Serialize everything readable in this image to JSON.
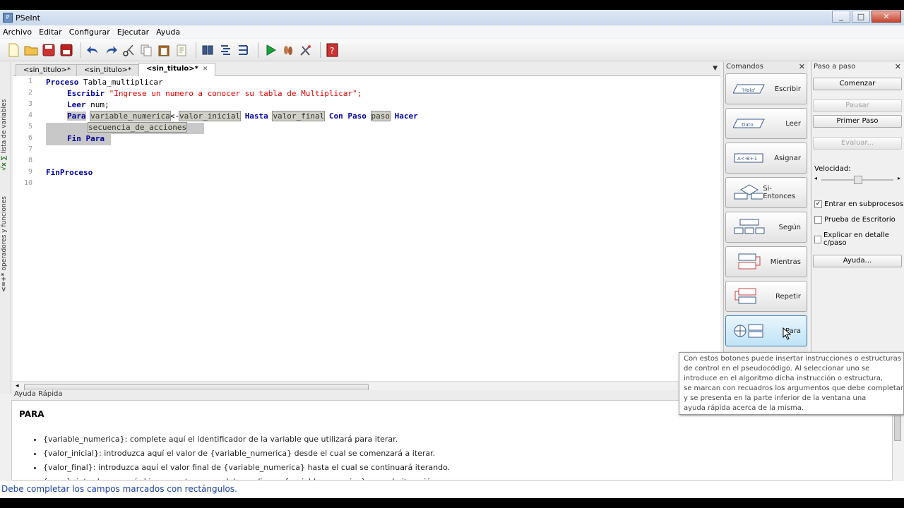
{
  "window": {
    "title": "PSeInt"
  },
  "menu": [
    "Archivo",
    "Editar",
    "Configurar",
    "Ejecutar",
    "Ayuda"
  ],
  "toolbar": {
    "icons": [
      "new-file-icon",
      "open-folder-icon",
      "save-icon",
      "save-as-icon",
      "undo-icon",
      "redo-icon",
      "cut-icon",
      "copy-icon",
      "paste-icon",
      "edit-icon",
      "search-icon",
      "indent-icon",
      "flowchart-icon",
      "run-icon",
      "step-icon",
      "debug-icon",
      "help-icon"
    ]
  },
  "left_tabs": {
    "variables": "lista de variables",
    "operators": "operadores y funciones"
  },
  "editor": {
    "tabs": [
      "<sin_titulo>*",
      "<sin_titulo>*",
      "<sin_titulo>*"
    ],
    "lines": [
      {
        "n": "1",
        "a": "Proceso",
        "b": " Tabla_multiplicar"
      },
      {
        "n": "2",
        "a": "Escribir",
        "b": " \"Ingrese un numero a conocer su tabla de Multiplicar\";"
      },
      {
        "n": "3",
        "a": "Leer",
        "b": " num;"
      },
      {
        "n": "4",
        "a": "Para",
        "v1": "variable_numerica",
        "arrow": "<-",
        "v2": "valor_inicial",
        "k1": "Hasta",
        "v3": "valor_final",
        "k2": "Con Paso",
        "v4": "paso",
        "k3": "Hacer"
      },
      {
        "n": "5",
        "v": "secuencia_de_acciones"
      },
      {
        "n": "6",
        "a": "Fin Para"
      },
      {
        "n": "7"
      },
      {
        "n": "8"
      },
      {
        "n": "9",
        "a": "FinProceso"
      },
      {
        "n": "10"
      }
    ]
  },
  "ayuda": {
    "header": "Ayuda Rápida",
    "title": "PARA",
    "items": [
      "{variable_numerica}: complete aquí el identificador de la variable que utilizará para iterar.",
      "{valor_inicial}: introduzca aquí el valor de {variable_numerica} desde el cual se comenzará a iterar.",
      "{valor_final}: introduzca aquí el valor final de {variable_numerica} hasta el cual se continuará iterando.",
      "{paso}: introduzca aquí el incremente que se debe realizar a {variable_numerica} en cada iteración."
    ]
  },
  "comandos": {
    "header": "Comandos",
    "buttons": [
      "Escribir",
      "Leer",
      "Asignar",
      "Si-Entonces",
      "Según",
      "Mientras",
      "Repetir",
      "Para"
    ]
  },
  "paso": {
    "header": "Paso a paso",
    "comenzar": "Comenzar",
    "pausar": "Pausar",
    "primer": "Primer Paso",
    "evaluar": "Evaluar...",
    "velocidad": "Velocidad:",
    "chk1": "Entrar en subprocesos",
    "chk2": "Prueba de Escritorio",
    "chk3": "Explicar en detalle c/paso",
    "ayuda": "Ayuda..."
  },
  "tooltip": [
    "Con estos botones puede insertar instrucciones o estructuras",
    "de control en el pseudocódigo. Al seleccionar uno se",
    "introduce en el algoritmo dicha instrucción o estructura,",
    "se marcan con recuadros los argumentos que debe completar,",
    "y se presenta en la parte inferior de la ventana una",
    "ayuda rápida acerca de la misma."
  ],
  "status": "Debe completar los campos marcados con rectángulos.",
  "colors": {
    "keyword": "#0000a0",
    "string": "#e00000",
    "status": "#1a3fa3"
  }
}
